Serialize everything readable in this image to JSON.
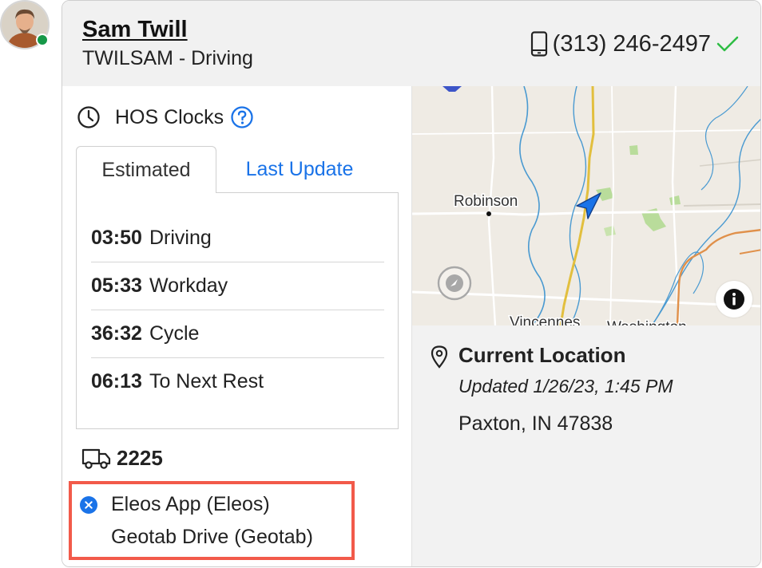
{
  "driver": {
    "name": "Sam Twill",
    "status_line": "TWILSAM - Driving",
    "phone": "(313) 246-2497",
    "online_color": "#169848",
    "phone_verified_color": "#2ebd44"
  },
  "hos": {
    "title": "HOS Clocks",
    "tabs": [
      {
        "label": "Estimated",
        "active": true
      },
      {
        "label": "Last Update",
        "active": false
      }
    ],
    "clocks": [
      {
        "time": "03:50",
        "label": "Driving"
      },
      {
        "time": "05:33",
        "label": "Workday"
      },
      {
        "time": "36:32",
        "label": "Cycle"
      },
      {
        "time": "06:13",
        "label": "To Next Rest"
      }
    ]
  },
  "vehicle": {
    "number": "2225",
    "icon": "truck-icon"
  },
  "eld": {
    "icon": "cancel-circle-icon",
    "icon_color": "#1a73e8",
    "highlight_color": "#f25a4a",
    "devices": [
      "Eleos App (Eleos)",
      "Geotab Drive (Geotab)"
    ]
  },
  "map": {
    "labels": {
      "robinson": "Robinson",
      "vincennes": "Vincennes",
      "washington": "Washington"
    },
    "heading_icon": "navigation-arrow-icon",
    "colors": {
      "land": "#efebe4",
      "highway": "#e2bf3e",
      "water": "#4a9ad1",
      "road_orange": "#e0904a",
      "park": "#b9dc9b"
    }
  },
  "location": {
    "title": "Current Location",
    "updated": "Updated 1/26/23, 1:45 PM",
    "address": "Paxton, IN 47838"
  },
  "colors": {
    "link": "#1a73e8",
    "header_bg": "#f1f1f1"
  }
}
